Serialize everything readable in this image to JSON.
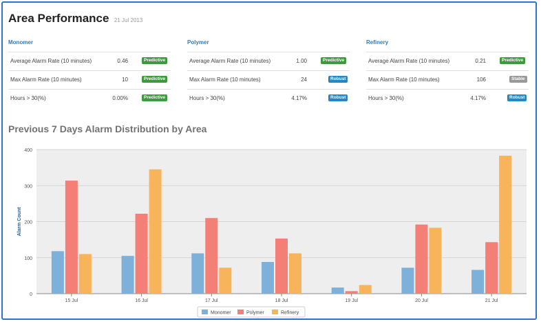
{
  "header": {
    "title": "Area Performance",
    "date": "21 Jul 2013"
  },
  "areas": [
    {
      "name": "Monomer",
      "rows": [
        {
          "label": "Average Alarm Rate (10 minutes)",
          "value": "0.46",
          "badge": "Predictive"
        },
        {
          "label": "Max Alarm Rate (10 minutes)",
          "value": "10",
          "badge": "Predictive"
        },
        {
          "label": "Hours > 30(%)",
          "value": "0.00%",
          "badge": "Predictive"
        }
      ]
    },
    {
      "name": "Polymer",
      "rows": [
        {
          "label": "Average Alarm Rate (10 minutes)",
          "value": "1.00",
          "badge": "Predictive"
        },
        {
          "label": "Max Alarm Rate (10 minutes)",
          "value": "24",
          "badge": "Robust"
        },
        {
          "label": "Hours > 30(%)",
          "value": "4.17%",
          "badge": "Robust"
        }
      ]
    },
    {
      "name": "Refinery",
      "rows": [
        {
          "label": "Average Alarm Rate (10 minutes)",
          "value": "0.21",
          "badge": "Predictive"
        },
        {
          "label": "Max Alarm Rate (10 minutes)",
          "value": "106",
          "badge": "Stable"
        },
        {
          "label": "Hours > 30(%)",
          "value": "4.17%",
          "badge": "Robust"
        }
      ]
    }
  ],
  "badge_colors": {
    "Predictive": "#3d9a3d",
    "Robust": "#2a86c0",
    "Stable": "#999999"
  },
  "chart_title": "Previous 7 Days Alarm Distribution by Area",
  "chart_data": {
    "type": "bar",
    "title": "Previous 7 Days Alarm Distribution by Area",
    "xlabel": "",
    "ylabel": "Alarm Count",
    "categories": [
      "15 Jul",
      "16 Jul",
      "17 Jul",
      "18 Jul",
      "19 Jul",
      "20 Jul",
      "21 Jul"
    ],
    "series": [
      {
        "name": "Monomer",
        "color": "#7eb1da",
        "values": [
          118,
          105,
          112,
          88,
          17,
          72,
          66
        ]
      },
      {
        "name": "Polymer",
        "color": "#f47f76",
        "values": [
          314,
          222,
          210,
          153,
          7,
          192,
          143
        ]
      },
      {
        "name": "Refinery",
        "color": "#f8b45a",
        "values": [
          110,
          345,
          72,
          112,
          24,
          183,
          383
        ]
      }
    ],
    "ylim": [
      0,
      400
    ],
    "yticks": [
      0,
      100,
      200,
      300,
      400
    ],
    "grid": true,
    "legend": "bottom-center"
  }
}
